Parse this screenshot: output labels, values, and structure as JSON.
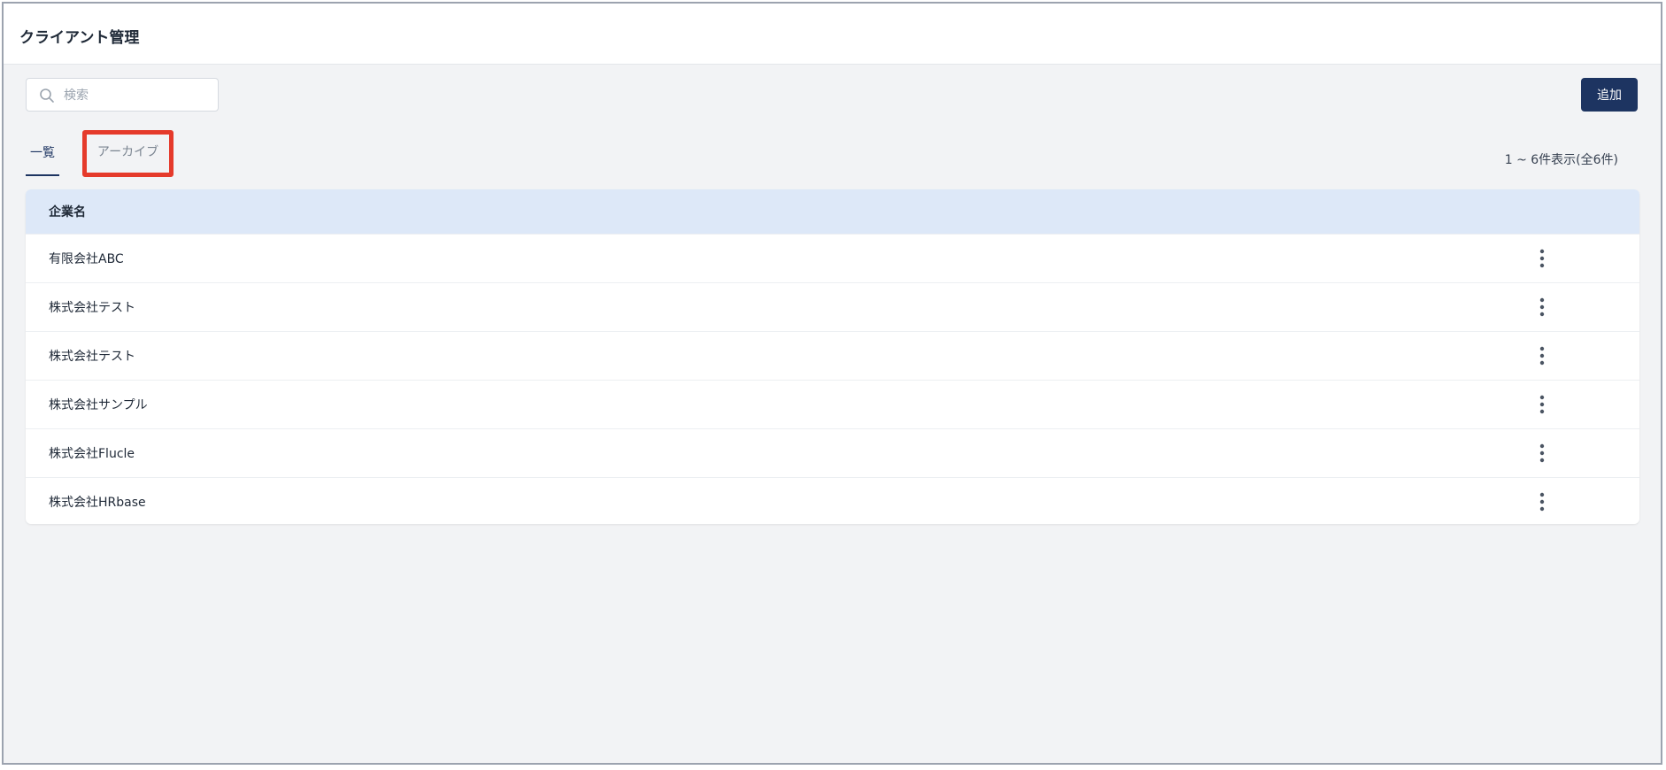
{
  "header": {
    "title": "クライアント管理"
  },
  "search": {
    "placeholder": "検索",
    "value": ""
  },
  "toolbar": {
    "add_label": "追加"
  },
  "tabs": [
    {
      "label": "一覧",
      "active": true
    },
    {
      "label": "アーカイブ",
      "active": false,
      "highlighted": true
    }
  ],
  "pagination": {
    "summary": "1 ~ 6件表示(全6件)"
  },
  "table": {
    "columns": [
      "企業名"
    ],
    "rows": [
      {
        "name": "有限会社ABC"
      },
      {
        "name": "株式会社テスト"
      },
      {
        "name": "株式会社テスト"
      },
      {
        "name": "株式会社サンプル"
      },
      {
        "name": "株式会社Flucle"
      },
      {
        "name": "株式会社HRbase"
      }
    ]
  },
  "icons": {
    "search": "search-icon",
    "row_menu": "more-vertical-icon"
  },
  "colors": {
    "accent": "#1d3461",
    "highlight_border": "#e53a2b",
    "table_header_bg": "#dde8f8",
    "page_bg": "#f2f3f5"
  }
}
